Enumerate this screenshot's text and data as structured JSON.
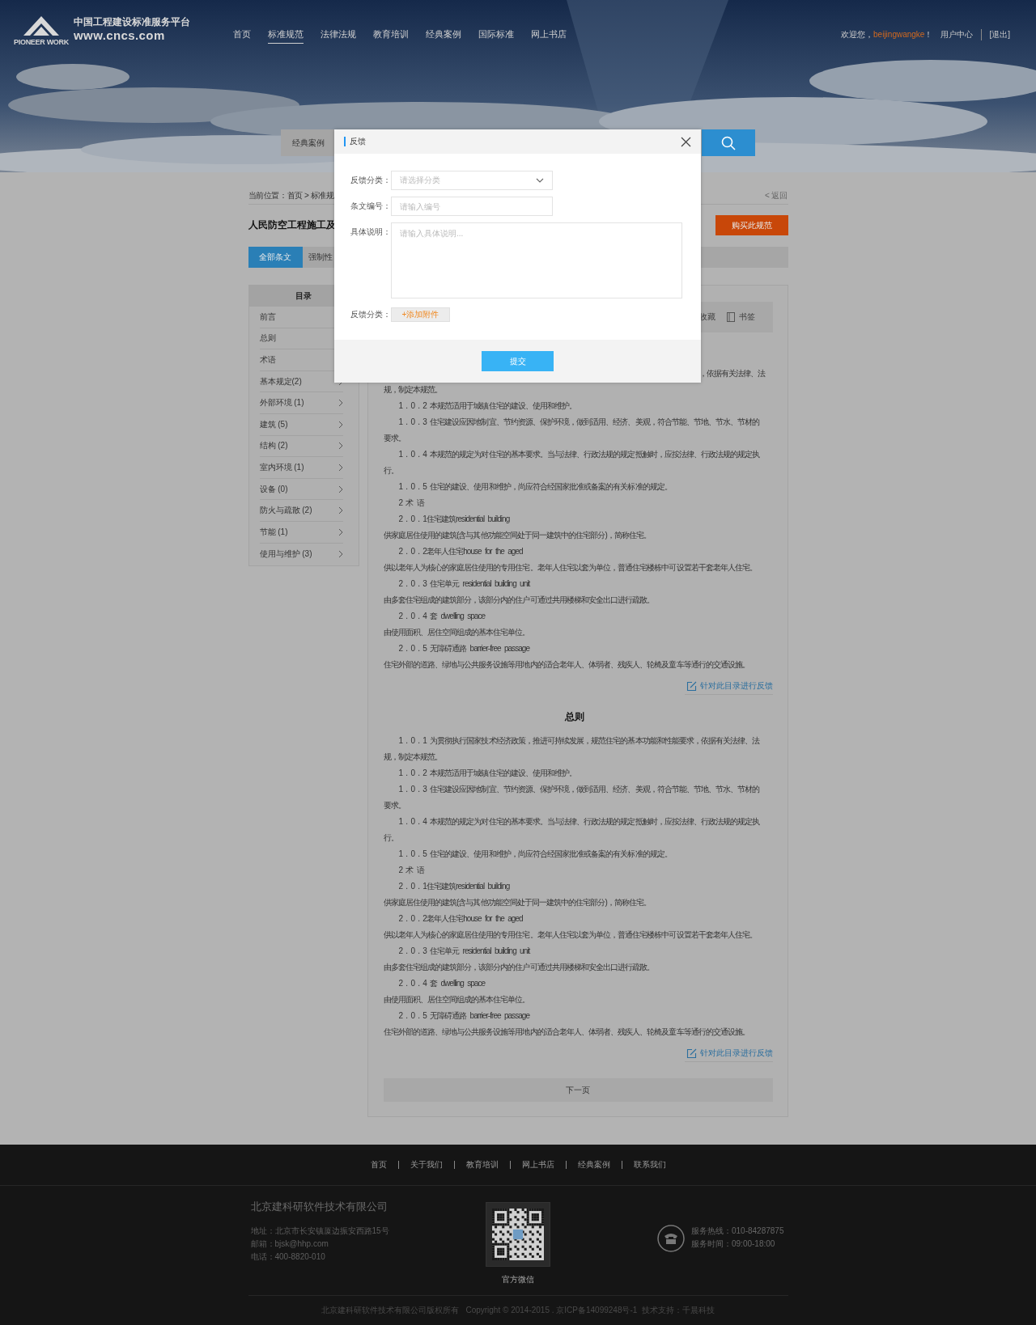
{
  "header": {
    "logo": {
      "brand": "PIONEER WORK",
      "title": "中国工程建设标准服务平台",
      "url": "www.cncs.com"
    },
    "nav": [
      {
        "label": "首页",
        "selected": false
      },
      {
        "label": "标准规范",
        "selected": true
      },
      {
        "label": "法律法规",
        "selected": false
      },
      {
        "label": "教育培训",
        "selected": false
      },
      {
        "label": "经典案例",
        "selected": false
      },
      {
        "label": "国际标准",
        "selected": false
      },
      {
        "label": "网上书店",
        "selected": false
      }
    ],
    "user": {
      "greeting": "欢迎您，",
      "username": "beijingwangke",
      "exclaim": "！",
      "links": [
        "用户中心",
        "[退出]"
      ]
    }
  },
  "search": {
    "category": "经典案例"
  },
  "breadcrumb": "当前位置：首页 > 标准规",
  "back": "< 返回",
  "title": "人民防空工程施工及",
  "buy_button": "购买此规范",
  "tabs": [
    {
      "label": "全部条文",
      "selected": true
    },
    {
      "label": "强制性",
      "selected": false
    }
  ],
  "sidebar": {
    "title": "目录",
    "items": [
      {
        "label": "前言"
      },
      {
        "label": "总则"
      },
      {
        "label": "术语"
      },
      {
        "label": "基本规定(2)",
        "arrow": true
      },
      {
        "label": "外部环境 (1)",
        "arrow": true
      },
      {
        "label": "建筑 (5)",
        "arrow": true
      },
      {
        "label": "结构 (2)",
        "arrow": true
      },
      {
        "label": "室内环境 (1)",
        "arrow": true
      },
      {
        "label": "设备 (0)",
        "arrow": true
      },
      {
        "label": "防火与疏散 (2)",
        "arrow": true
      },
      {
        "label": "节能 (1)",
        "arrow": true
      },
      {
        "label": "使用与维护 (3)",
        "arrow": true
      }
    ]
  },
  "toolbar": [
    {
      "label": "收藏",
      "icon": false
    },
    {
      "label": "书签",
      "icon": true
    }
  ],
  "sections": [
    {
      "lead": "，依据有关法律、法",
      "paragraphs": [
        {
          "kind": "body",
          "text": "规，制定本规范。"
        },
        {
          "kind": "indent",
          "text": "1 . 0 . 2 本规范适用于城镇住宅的建设、使用和维护。"
        },
        {
          "kind": "indent",
          "text": "1 . 0 . 3 住宅建设应因地制宜、节约资源、保护环境，做到适用、经济、美观，符合节能、节地、节水、节材的要求。"
        },
        {
          "kind": "indent",
          "text": "1 . 0 . 4 本规范的规定为对住宅的基本要求。当与法律、行政法规的规定抵触时，应按法律、行政法规的规定执行。"
        },
        {
          "kind": "indent",
          "text": "1 . 0 . 5 住宅的建设、使用和维护，尚应符合经国家批准或备案的有关标准的规定。"
        },
        {
          "kind": "indent",
          "text": "2 术 语"
        },
        {
          "kind": "indent",
          "text": "2 . 0 . 1住宅建筑residential building"
        },
        {
          "kind": "body",
          "text": "供家庭居住使用的建筑(含与其他功能空间处于同一建筑中的住宅部分)，简称住宅。"
        },
        {
          "kind": "indent",
          "text": "2 . 0 . 2老年人住宅house for the aged"
        },
        {
          "kind": "body",
          "text": "供以老年人为核心的家庭居住使用的专用住宅。老年人住宅以套为单位，普通住宅楼栋中可设置若干套老年人住宅。"
        },
        {
          "kind": "indent",
          "text": "2 . 0 . 3 住宅单元 residential building unit"
        },
        {
          "kind": "body",
          "text": "由多套住宅组成的建筑部分，该部分内的住户可通过共用楼梯和安全出口进行疏散。"
        },
        {
          "kind": "indent",
          "text": "2 . 0 . 4 套 dwelling space"
        },
        {
          "kind": "body",
          "text": "由使用面积、居住空间组成的基本住宅单位。"
        },
        {
          "kind": "indent",
          "text": "2 . 0 . 5 无障碍通路 barrier-free passage"
        },
        {
          "kind": "body",
          "text": "住宅外部的道路、绿地与公共服务设施等用地内的适合老年人、体弱者、残疾人、轮椅及童车等通行的交通设施。"
        }
      ],
      "feedback_link": "针对此目录进行反馈"
    },
    {
      "heading": "总则",
      "paragraphs": [
        {
          "kind": "indent",
          "text": "1 . 0 . 1 为贯彻执行国家技术经济政策，推进可持续发展，规范住宅的基本功能和性能要求，依据有关法律、法规，制定本规范。"
        },
        {
          "kind": "indent",
          "text": "1 . 0 . 2 本规范适用于城镇住宅的建设、使用和维护。"
        },
        {
          "kind": "indent",
          "text": "1 . 0 . 3 住宅建设应因地制宜、节约资源、保护环境，做到适用、经济、美观，符合节能、节地、节水、节材的要求。"
        },
        {
          "kind": "indent",
          "text": "1 . 0 . 4 本规范的规定为对住宅的基本要求。当与法律、行政法规的规定抵触时，应按法律、行政法规的规定执行。"
        },
        {
          "kind": "indent",
          "text": "1 . 0 . 5 住宅的建设、使用和维护，尚应符合经国家批准或备案的有关标准的规定。"
        },
        {
          "kind": "indent",
          "text": "2 术 语"
        },
        {
          "kind": "indent",
          "text": "2 . 0 . 1住宅建筑residential building"
        },
        {
          "kind": "body",
          "text": "供家庭居住使用的建筑(含与其他功能空间处于同一建筑中的住宅部分)，简称住宅。"
        },
        {
          "kind": "indent",
          "text": "2 . 0 . 2老年人住宅house for the aged"
        },
        {
          "kind": "body",
          "text": "供以老年人为核心的家庭居住使用的专用住宅。老年人住宅以套为单位，普通住宅楼栋中可设置若干套老年人住宅。"
        },
        {
          "kind": "indent",
          "text": "2 . 0 . 3 住宅单元 residential building unit"
        },
        {
          "kind": "body",
          "text": "由多套住宅组成的建筑部分，该部分内的住户可通过共用楼梯和安全出口进行疏散。"
        },
        {
          "kind": "indent",
          "text": "2 . 0 . 4 套 dwelling space"
        },
        {
          "kind": "body",
          "text": "由使用面积、居住空间组成的基本住宅单位。"
        },
        {
          "kind": "indent",
          "text": "2 . 0 . 5 无障碍通路 barrier-free passage"
        },
        {
          "kind": "body",
          "text": "住宅外部的道路、绿地与公共服务设施等用地内的适合老年人、体弱者、残疾人、轮椅及童车等通行的交通设施。"
        }
      ],
      "feedback_link": "针对此目录进行反馈"
    }
  ],
  "next_page": "下一页",
  "modal": {
    "title": "反馈",
    "fields": [
      {
        "kind": "select",
        "label": "反馈分类：",
        "placeholder": "请选择分类"
      },
      {
        "kind": "input",
        "label": "条文编号：",
        "placeholder": "请输入编号"
      },
      {
        "kind": "textarea",
        "label": "具体说明：",
        "placeholder": "请输入具体说明..."
      },
      {
        "kind": "attach",
        "label": "反馈分类：",
        "button": "+添加附件"
      }
    ],
    "submit": "提交"
  },
  "footer": {
    "links": [
      "首页",
      "关于我们",
      "教育培训",
      "网上书店",
      "经典案例",
      "联系我们"
    ],
    "company": "北京建科研软件技术有限公司",
    "contacts": [
      "地址：北京市长安镇厦边振安西路15号",
      "邮箱：bjsk@hhp.com",
      "电话：400-8820-010"
    ],
    "qr_caption": "官方微信",
    "service": [
      "服务热线：010-84287875",
      "服务时间：09:00-18:00"
    ],
    "copyright": "北京建科研软件技术有限公司版权所有   Copyright © 2014-2015 . 京ICP备14099248号-1  技术支持：千晨科技"
  }
}
